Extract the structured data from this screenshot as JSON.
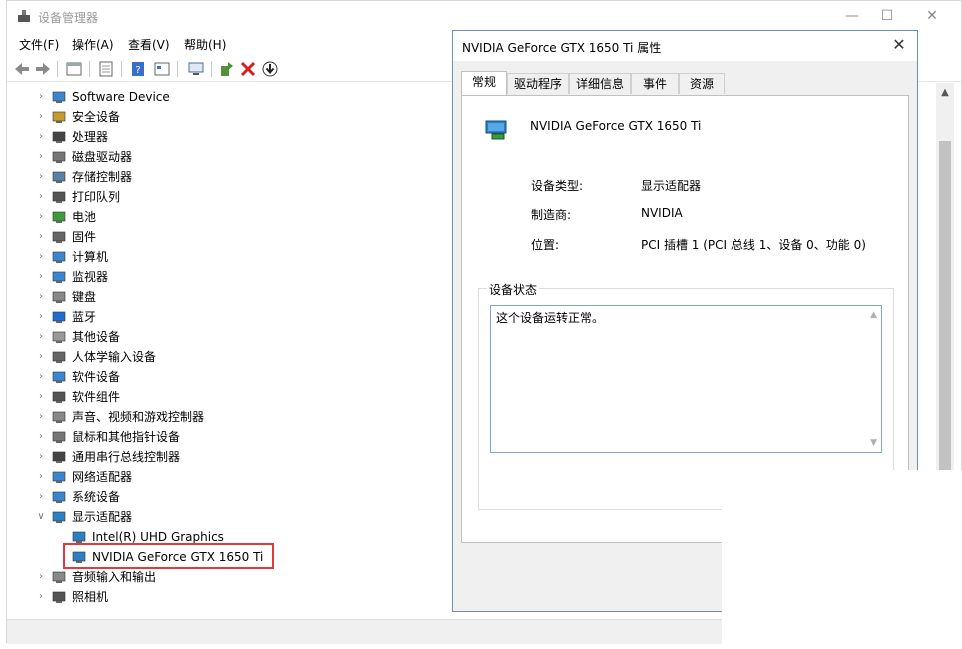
{
  "window": {
    "title": "设备管理器"
  },
  "menubar": [
    {
      "label": "文件(F)"
    },
    {
      "label": "操作(A)"
    },
    {
      "label": "查看(V)"
    },
    {
      "label": "帮助(H)"
    }
  ],
  "tree": {
    "items": [
      {
        "label": "Software Device",
        "icon": "software-device-icon",
        "expanded": false
      },
      {
        "label": "安全设备",
        "icon": "security-device-icon",
        "expanded": false
      },
      {
        "label": "处理器",
        "icon": "processor-icon",
        "expanded": false
      },
      {
        "label": "磁盘驱动器",
        "icon": "disk-drive-icon",
        "expanded": false
      },
      {
        "label": "存储控制器",
        "icon": "storage-controller-icon",
        "expanded": false
      },
      {
        "label": "打印队列",
        "icon": "printer-icon",
        "expanded": false
      },
      {
        "label": "电池",
        "icon": "battery-icon",
        "expanded": false
      },
      {
        "label": "固件",
        "icon": "firmware-icon",
        "expanded": false
      },
      {
        "label": "计算机",
        "icon": "computer-icon",
        "expanded": false
      },
      {
        "label": "监视器",
        "icon": "monitor-icon",
        "expanded": false
      },
      {
        "label": "键盘",
        "icon": "keyboard-icon",
        "expanded": false
      },
      {
        "label": "蓝牙",
        "icon": "bluetooth-icon",
        "expanded": false
      },
      {
        "label": "其他设备",
        "icon": "other-devices-icon",
        "expanded": false
      },
      {
        "label": "人体学输入设备",
        "icon": "hid-icon",
        "expanded": false
      },
      {
        "label": "软件设备",
        "icon": "software-device-icon",
        "expanded": false
      },
      {
        "label": "软件组件",
        "icon": "software-component-icon",
        "expanded": false
      },
      {
        "label": "声音、视频和游戏控制器",
        "icon": "sound-icon",
        "expanded": false
      },
      {
        "label": "鼠标和其他指针设备",
        "icon": "mouse-icon",
        "expanded": false
      },
      {
        "label": "通用串行总线控制器",
        "icon": "usb-icon",
        "expanded": false
      },
      {
        "label": "网络适配器",
        "icon": "network-adapter-icon",
        "expanded": false
      },
      {
        "label": "系统设备",
        "icon": "system-device-icon",
        "expanded": false
      },
      {
        "label": "显示适配器",
        "icon": "display-adapter-icon",
        "expanded": true
      },
      {
        "label": "Intel(R) UHD Graphics",
        "icon": "display-adapter-icon",
        "child": true
      },
      {
        "label": "NVIDIA GeForce GTX 1650 Ti",
        "icon": "display-adapter-icon",
        "child": true,
        "selected": true
      },
      {
        "label": "音频输入和输出",
        "icon": "audio-io-icon",
        "expanded": false
      },
      {
        "label": "照相机",
        "icon": "camera-icon",
        "expanded": false
      }
    ]
  },
  "dialog": {
    "title": "NVIDIA GeForce GTX 1650 Ti 属性",
    "tabs": [
      {
        "label": "常规",
        "active": true
      },
      {
        "label": "驱动程序"
      },
      {
        "label": "详细信息"
      },
      {
        "label": "事件"
      },
      {
        "label": "资源"
      }
    ],
    "device_name": "NVIDIA GeForce GTX 1650 Ti",
    "properties": [
      {
        "key": "设备类型:",
        "value": "显示适配器"
      },
      {
        "key": "制造商:",
        "value": "NVIDIA"
      },
      {
        "key": "位置:",
        "value": "PCI 插槽 1 (PCI 总线 1、设备 0、功能 0)"
      }
    ],
    "status_group_title": "设备状态",
    "status_text": "这个设备运转正常。"
  },
  "colors": {
    "selection_outline": "#e03a3a",
    "status_border": "#7aa7d6",
    "dialog_border": "#6e8fb0"
  }
}
